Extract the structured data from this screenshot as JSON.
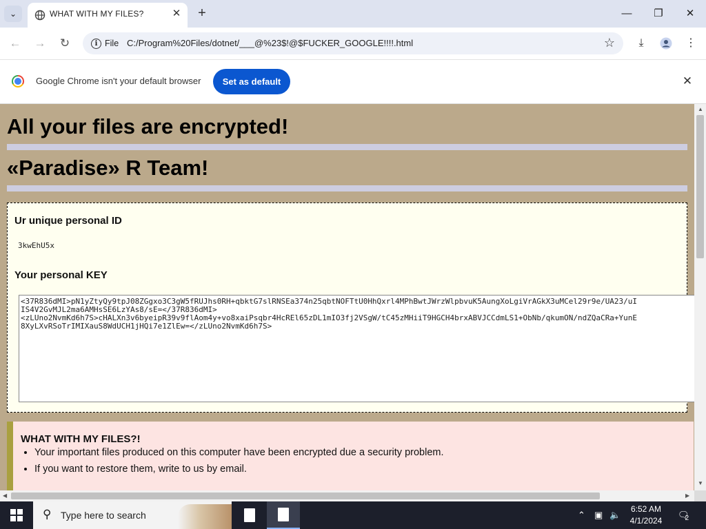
{
  "browser": {
    "tab_title": "WHAT WITH MY FILES?",
    "omnibox": {
      "scheme_label": "File",
      "url": "C:/Program%20Files/dotnet/___@%23$!@$FUCKER_GOOGLE!!!!.html"
    },
    "icons": {
      "tab_search": "chevron-down-icon",
      "new_tab": "plus-icon",
      "minimize": "minimize-icon",
      "maximize": "restore-icon",
      "close": "close-icon",
      "back": "back-arrow-icon",
      "forward": "forward-arrow-icon",
      "reload": "reload-icon",
      "info": "info-icon",
      "bookmark": "star-icon",
      "downloads": "download-icon",
      "profile": "profile-icon",
      "menu": "kebab-menu-icon"
    }
  },
  "infobar": {
    "message": "Google Chrome isn't your default browser",
    "button_label": "Set as default"
  },
  "page": {
    "heading_1": "All your files are encrypted!",
    "heading_2": "«Paradise» R Team!",
    "id_section": {
      "id_label": "Ur unique personal ID",
      "id_value": "3kwEhU5x",
      "key_label": "Your personal KEY",
      "key_lines": [
        "<37R836dMI>pN1yZtyQy9tpJ08ZGgxo3C3gW5fRUJhs0RH+qbktG7slRNSEa374n25qbtNOFTtU0HhQxrl4MPhBwtJWrzWlpbvuK5AungXoLgiVrAGkX3uMCel29r9e/UA23/uI",
        "IS4V2GvMJL2ma6AMHsSE6LzYAs8/sE=</37R836dMI>",
        "<zLUno2NvmKd6h7S>cHALXn3v6byeipR39v9flAom4y+vo8xaiPsqbr4HcREl65zDL1mIO3fj2VSgW/tC45zMHiiT9HGCH4brxABVJCCdmLS1+ObNb/qkumON/ndZQaCRa+YunE",
        "8XyLXvRSoTrIMIXauS8WdUCH1jHQi7e1ZlEw=</zLUno2NvmKd6h7S>"
      ]
    },
    "warning": {
      "title": "WHAT WITH MY FILES?!",
      "items": [
        "Your important files produced on this computer have been encrypted due a security problem.",
        "If you want to restore them, write to us by email."
      ]
    },
    "colors": {
      "background": "#bba98b",
      "rule": "#cdcde0",
      "id_box": "#fffff0",
      "warning_box": "#fde4e2",
      "warning_border": "#a9a040",
      "button_blue": "#0b57d0"
    }
  },
  "taskbar": {
    "search_placeholder": "Type here to search",
    "time": "6:52 AM",
    "date": "4/1/2024",
    "notification_count": "2",
    "icons": {
      "start": "windows-logo-icon",
      "search": "search-icon",
      "app_1": "document-icon",
      "app_2": "document-icon",
      "tray_chevron": "chevron-up-icon",
      "network": "network-icon",
      "volume": "volume-muted-icon",
      "notifications": "notification-icon"
    }
  }
}
